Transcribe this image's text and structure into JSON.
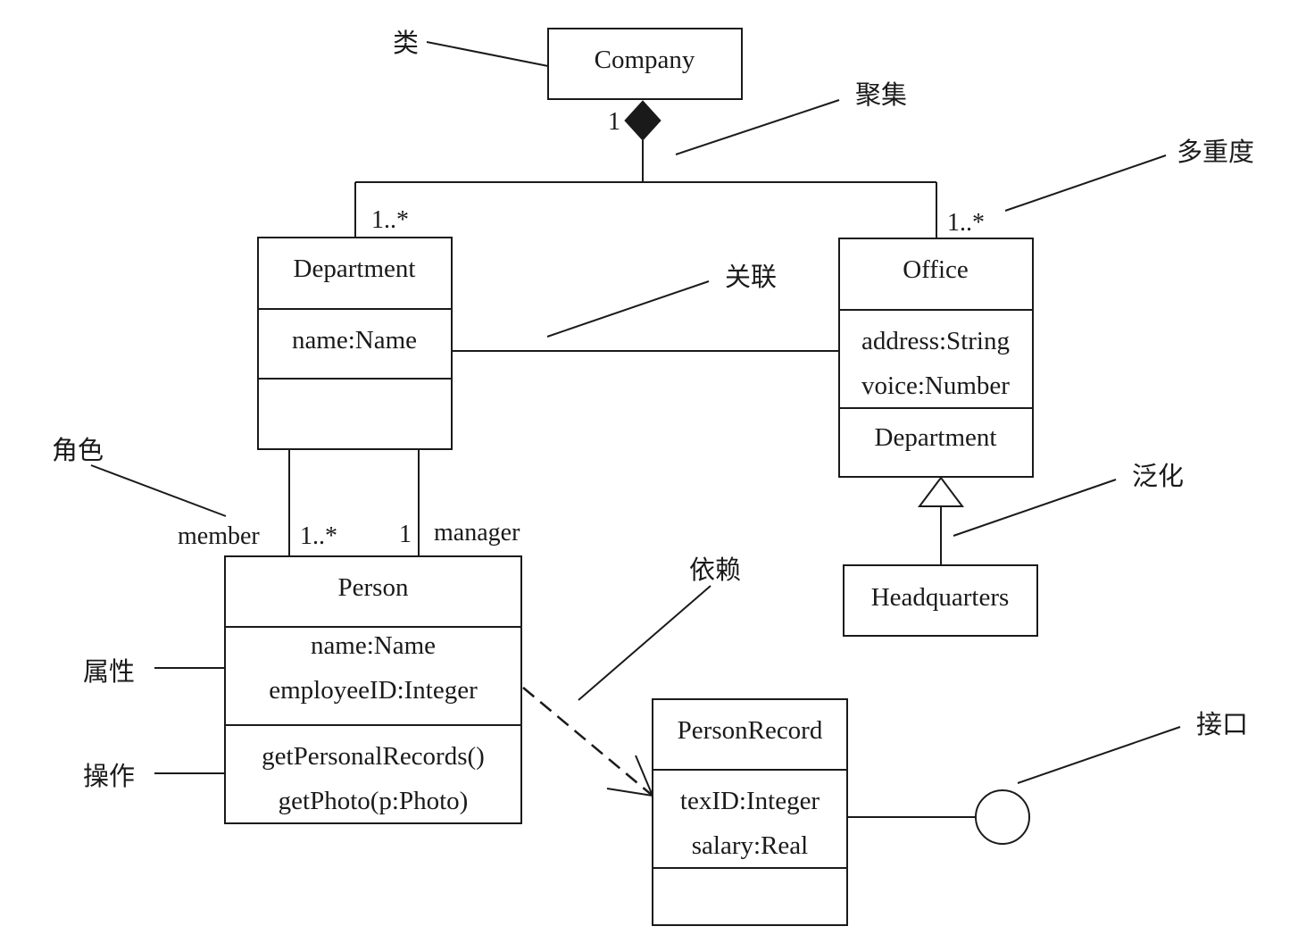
{
  "classes": {
    "company": {
      "name": "Company"
    },
    "department": {
      "name": "Department",
      "attributes": [
        "name:Name"
      ]
    },
    "office": {
      "name": "Office",
      "attributes": [
        "address:String",
        "voice:Number"
      ],
      "operations": [
        "Department"
      ]
    },
    "headquarters": {
      "name": "Headquarters"
    },
    "person": {
      "name": "Person",
      "attributes": [
        "name:Name",
        "employeeID:Integer"
      ],
      "operations": [
        "getPersonalRecords()",
        "getPhoto(p:Photo)"
      ]
    },
    "person_record": {
      "name": "PersonRecord",
      "attributes": [
        "texID:Integer",
        "salary:Real"
      ]
    }
  },
  "multiplicities": {
    "company_side": "1",
    "department_side": "1..*",
    "office_side": "1..*",
    "member_side": "1..*",
    "manager_side": "1"
  },
  "roles": {
    "member": "member",
    "manager": "manager"
  },
  "annotations": {
    "class": "类",
    "aggregation": "聚集",
    "multiplicity": "多重度",
    "association": "关联",
    "role": "角色",
    "generalization": "泛化",
    "dependency": "依赖",
    "attribute": "属性",
    "operation": "操作",
    "interface": "接口"
  }
}
